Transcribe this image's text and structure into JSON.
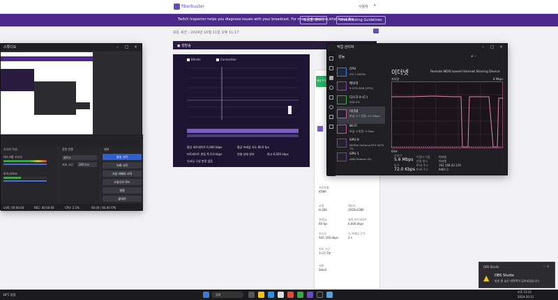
{
  "site": {
    "logo": "fiberbuster",
    "user": "사용자"
  },
  "banner": {
    "message": "Twitch Inspector helps you diagnose issues with your broadcast. For more information, check out the",
    "buttons": [
      "도움말 페이지",
      "Broadcasting Guidelines"
    ]
  },
  "page": {
    "breadcrumb": "모든 세션 › 2024년 10월 11일 오후 11:17",
    "live_label": "● 생방송",
    "chart_legend": [
      "Bitrate",
      "Connection"
    ],
    "bottom_stats": [
      "평균 비트레이트 6,000 kbps",
      "평균 프레임 속도 60.0 fps",
      "비트레이트 변동 폭 0.0 kbps",
      "연결 상태 양호",
      "인코딩 구성 변경 없음",
      "최고 6,020 kbps"
    ],
    "side_stats": [
      [
        "프로토콜",
        "RTMP"
      ],
      [
        "코덱",
        "H.264"
      ],
      [
        "해상도",
        "1920x1080"
      ],
      [
        "프레임",
        "60 fps"
      ],
      [
        "최대 비트레이트",
        "6,000 kbps"
      ],
      [
        "오디오",
        "AAC 160 kbps"
      ],
      [
        "키 프레임 간격",
        "2 s"
      ],
      [
        "지속 시간",
        "1시간 2분"
      ],
      [
        "서버",
        "Seoul"
      ]
    ],
    "side_button": "세션 보기"
  },
  "obs": {
    "title": "스튜디오",
    "sections": [
      "오디오 믹서",
      "장면 전환",
      "제어"
    ],
    "mixer_rows": [
      "데스크톱 오디오",
      "마이크/보조"
    ],
    "transition_value": "페이드",
    "duration_label": "지속 시간",
    "duration_value": "300 ms",
    "controls": [
      "방송 시작",
      "녹화 시작",
      "가상 카메라 시작",
      "스튜디오 모드",
      "설정",
      "끝내기"
    ],
    "status": [
      "LIVE: 00:00:00",
      "REC: 00:00:00",
      "CPU: 2.1%",
      "60.00 / 60.00 FPS"
    ]
  },
  "taskmgr": {
    "title": "작업 관리자",
    "section": "성능",
    "items": [
      {
        "name": "CPU",
        "detail": "5% 1.26GHz"
      },
      {
        "name": "메모리",
        "detail": "9.2/31.8GB (29%)"
      },
      {
        "name": "디스크 0 (C:)",
        "detail": "SSD 0%"
      },
      {
        "name": "이더넷",
        "detail": "보냄: 5.7 받음: 0.1 Mbps"
      },
      {
        "name": "Wi-Fi",
        "detail": "보냄: 0 받음: 0 Kbps"
      },
      {
        "name": "GPU 0",
        "detail": "NVIDIA GeForce RTX 4070 7%"
      },
      {
        "name": "GPU 1",
        "detail": "AMD Radeon 0%"
      }
    ],
    "heading": "이더넷",
    "adapter": "Remote NDIS based Internet Sharing Device",
    "graph_label": "처리량",
    "graph_max": "8 Mbps",
    "graph_time": "60초",
    "send_label": "보내기",
    "send_value": "5.6 Mbps",
    "recv_label": "받기",
    "recv_value": "72.0 Kbps",
    "props": [
      [
        "어댑터 이름",
        "이더넷"
      ],
      [
        "연결 형식",
        "이더넷"
      ],
      [
        "IPv4 주소",
        "192.168.42.129"
      ],
      [
        "IPv6 주소",
        "fe80::1"
      ]
    ]
  },
  "toast": {
    "app": "OBS Studio",
    "title": "OBS Studio",
    "body": "방송 중 높은 대역폭이 감지되었습니다"
  },
  "taskbar": {
    "weather": "18°C 맑음",
    "search": "검색",
    "time": "오후 11:21",
    "date": "2024-10-11"
  }
}
